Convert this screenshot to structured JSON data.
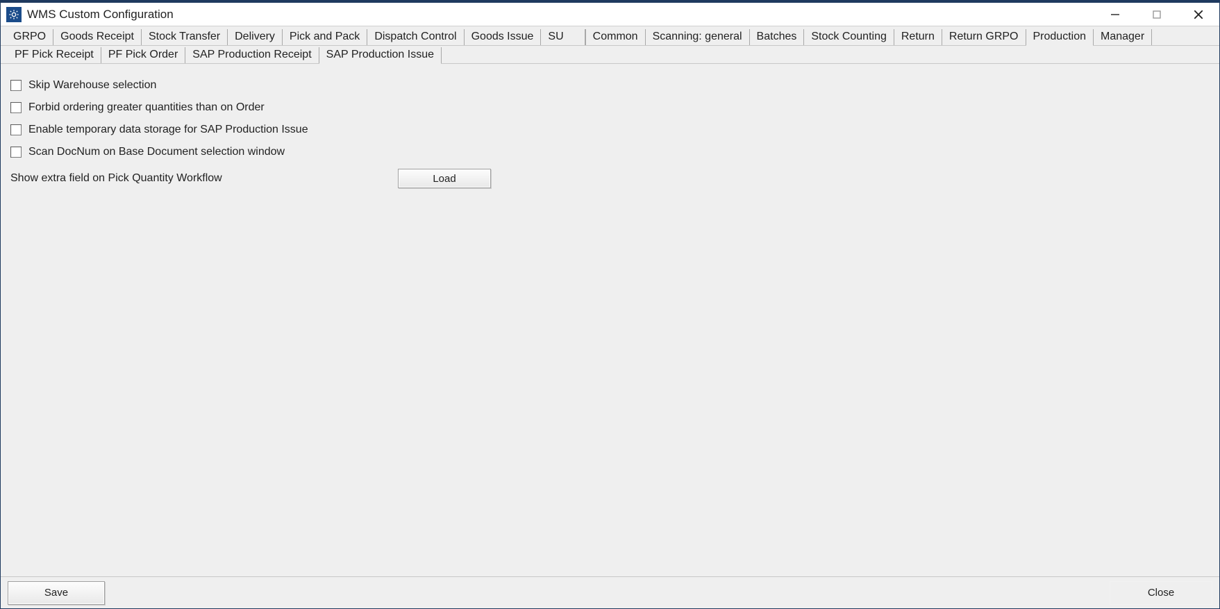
{
  "window": {
    "title": "WMS Custom Configuration"
  },
  "tabs": {
    "primary": [
      {
        "label": "GRPO",
        "active": false
      },
      {
        "label": "Goods Receipt",
        "active": false
      },
      {
        "label": "Stock Transfer",
        "active": false
      },
      {
        "label": "Delivery",
        "active": false
      },
      {
        "label": "Pick and Pack",
        "active": false
      },
      {
        "label": "Dispatch Control",
        "active": false
      },
      {
        "label": "Goods Issue",
        "active": false
      },
      {
        "label": "SU",
        "active": false
      },
      {
        "label": "Common",
        "active": false
      },
      {
        "label": "Scanning: general",
        "active": false
      },
      {
        "label": "Batches",
        "active": false
      },
      {
        "label": "Stock Counting",
        "active": false
      },
      {
        "label": "Return",
        "active": false
      },
      {
        "label": "Return GRPO",
        "active": false
      },
      {
        "label": "Production",
        "active": true
      },
      {
        "label": "Manager",
        "active": false
      }
    ],
    "secondary": [
      {
        "label": "PF Pick Receipt",
        "active": false
      },
      {
        "label": "PF Pick Order",
        "active": false
      },
      {
        "label": "SAP Production Receipt",
        "active": false
      },
      {
        "label": "SAP Production Issue",
        "active": true
      }
    ]
  },
  "content": {
    "checkboxes": [
      {
        "label": "Skip Warehouse selection",
        "checked": false
      },
      {
        "label": "Forbid ordering greater quantities than on Order",
        "checked": false
      },
      {
        "label": "Enable temporary data storage for SAP Production Issue",
        "checked": false
      },
      {
        "label": "Scan DocNum on Base Document selection window",
        "checked": false
      }
    ],
    "extra_field_label": "Show extra field on Pick Quantity Workflow",
    "load_button": "Load"
  },
  "footer": {
    "save_label": "Save",
    "close_label": "Close"
  }
}
